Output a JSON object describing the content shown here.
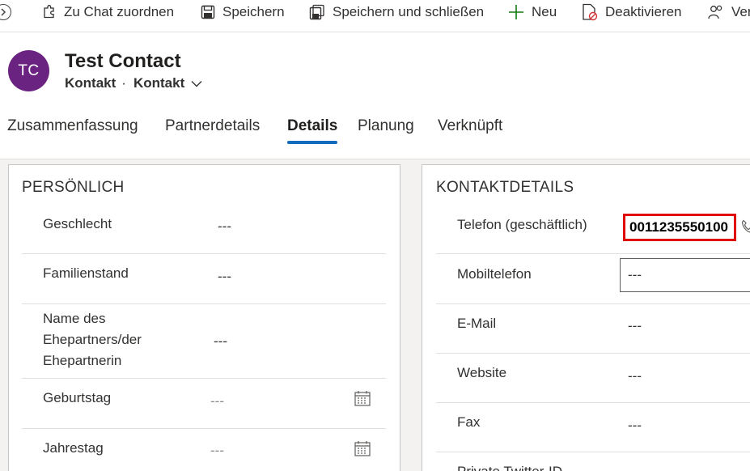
{
  "commands": {
    "assign_chat": "Zu Chat zuordnen",
    "save": "Speichern",
    "save_close": "Speichern und schließen",
    "new": "Neu",
    "deactivate": "Deaktivieren",
    "more_partial": "Ver"
  },
  "record": {
    "initials": "TC",
    "title": "Test Contact",
    "entity": "Kontakt",
    "separator": "·",
    "form": "Kontakt",
    "avatar_color": "#6b2381"
  },
  "tabs": [
    "Zusammenfassung",
    "Partnerdetails",
    "Details",
    "Planung",
    "Verknüpft"
  ],
  "active_tab": "Details",
  "accent_color": "#0f6cbd",
  "personal": {
    "title": "PERSÖNLICH",
    "fields": [
      {
        "label": "Geschlecht",
        "value": "---"
      },
      {
        "label": "Familienstand",
        "value": "---"
      },
      {
        "label": "Name des Ehepartners/der Ehepartnerin",
        "value": "---"
      },
      {
        "label": "Geburtstag",
        "value": "---",
        "icon": "calendar-icon"
      },
      {
        "label": "Jahrestag",
        "value": "---",
        "icon": "calendar-icon"
      }
    ]
  },
  "contact": {
    "title": "KONTAKTDETAILS",
    "fields": [
      {
        "label": "Telefon (geschäftlich)",
        "value": "0011235550100",
        "highlight_color": "#e00000",
        "icon": "phone-icon"
      },
      {
        "label": "Mobiltelefon",
        "value": "---"
      },
      {
        "label": "E-Mail",
        "value": "---"
      },
      {
        "label": "Website",
        "value": "---"
      },
      {
        "label": "Fax",
        "value": "---"
      },
      {
        "label": "Private Twitter-ID",
        "value": ""
      }
    ]
  }
}
